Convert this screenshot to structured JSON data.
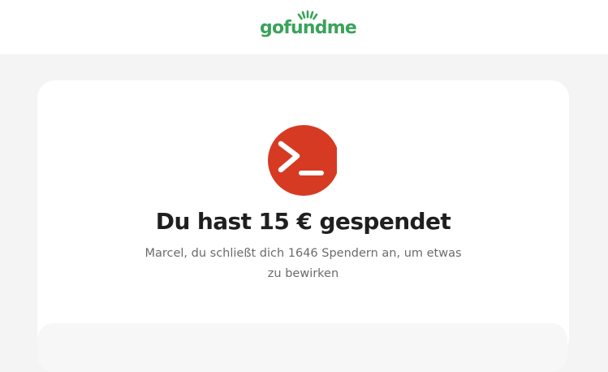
{
  "header": {
    "logo_text": "gofundme"
  },
  "colors": {
    "brand_green": "#3aa35a",
    "avatar_red": "#d63a23",
    "page_bg": "#f4f4f4"
  },
  "card": {
    "avatar_icon": "terminal-prompt-icon",
    "title": "Du hast 15 € gespendet",
    "message": "Marcel, du schließt dich 1646 Spendern an, um etwas zu bewirken"
  }
}
